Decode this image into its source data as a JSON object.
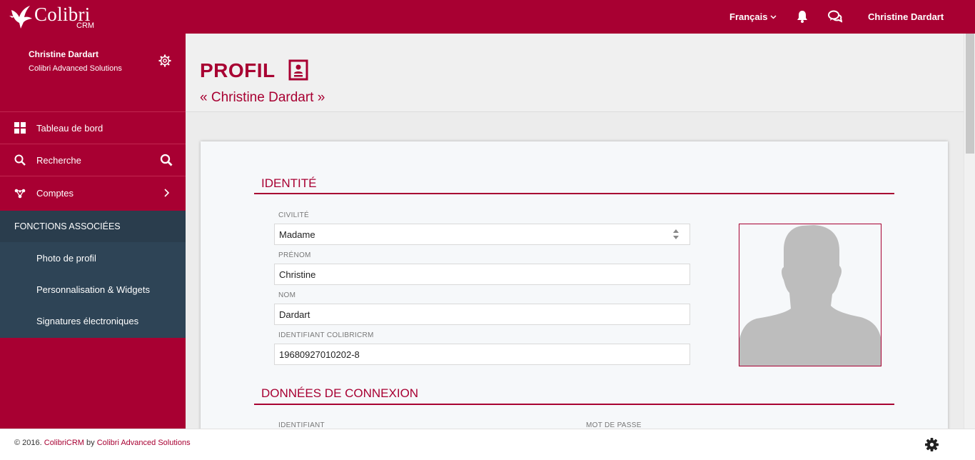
{
  "topbar": {
    "logo_name": "Colibri",
    "logo_sub": "CRM",
    "language": "Français",
    "user": "Christine Dardart"
  },
  "sidebar": {
    "profile_name": "Christine Dardart",
    "profile_company": "Colibri Advanced Solutions",
    "items": [
      {
        "label": "Tableau de bord",
        "icon": "dashboard-grid-icon"
      },
      {
        "label": "Recherche",
        "icon": "search-icon"
      },
      {
        "label": "Comptes",
        "icon": "accounts-network-icon"
      }
    ],
    "section_title": "FONCTIONS ASSOCIÉES",
    "sub_items": [
      {
        "label": "Photo de profil"
      },
      {
        "label": "Personnalisation & Widgets"
      },
      {
        "label": "Signatures électroniques"
      }
    ]
  },
  "page": {
    "title": "PROFIL",
    "subtitle": "« Christine Dardart »"
  },
  "identity": {
    "title": "IDENTITÉ",
    "civilite_label": "CIVILITÉ",
    "civilite_value": "Madame",
    "prenom_label": "PRÉNOM",
    "prenom_value": "Christine",
    "nom_label": "NOM",
    "nom_value": "Dardart",
    "identifiant_label": "IDENTIFIANT COLIBRICRM",
    "identifiant_value": "19680927010202-8"
  },
  "connexion": {
    "title": "DONNÉES DE CONNEXION",
    "login_label": "IDENTIFIANT",
    "password_label": "MOT DE PASSE"
  },
  "footer": {
    "prefix": "© 2016. ",
    "product": "ColibriCRM",
    "by": " by ",
    "company": "Colibri Advanced Solutions"
  },
  "colors": {
    "brand": "#a80032",
    "sidebar_section": "#2e4456"
  }
}
